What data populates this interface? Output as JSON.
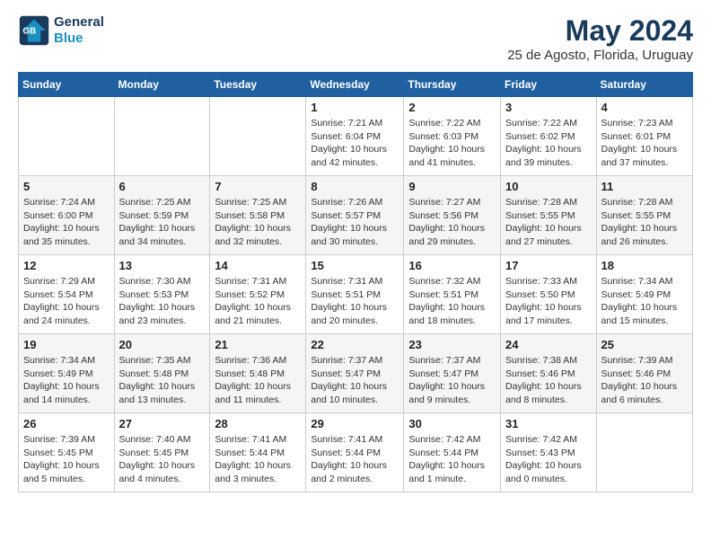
{
  "header": {
    "logo_line1": "General",
    "logo_line2": "Blue",
    "month": "May 2024",
    "location": "25 de Agosto, Florida, Uruguay"
  },
  "weekdays": [
    "Sunday",
    "Monday",
    "Tuesday",
    "Wednesday",
    "Thursday",
    "Friday",
    "Saturday"
  ],
  "weeks": [
    [
      {
        "day": "",
        "sunrise": "",
        "sunset": "",
        "daylight": ""
      },
      {
        "day": "",
        "sunrise": "",
        "sunset": "",
        "daylight": ""
      },
      {
        "day": "",
        "sunrise": "",
        "sunset": "",
        "daylight": ""
      },
      {
        "day": "1",
        "sunrise": "Sunrise: 7:21 AM",
        "sunset": "Sunset: 6:04 PM",
        "daylight": "Daylight: 10 hours and 42 minutes."
      },
      {
        "day": "2",
        "sunrise": "Sunrise: 7:22 AM",
        "sunset": "Sunset: 6:03 PM",
        "daylight": "Daylight: 10 hours and 41 minutes."
      },
      {
        "day": "3",
        "sunrise": "Sunrise: 7:22 AM",
        "sunset": "Sunset: 6:02 PM",
        "daylight": "Daylight: 10 hours and 39 minutes."
      },
      {
        "day": "4",
        "sunrise": "Sunrise: 7:23 AM",
        "sunset": "Sunset: 6:01 PM",
        "daylight": "Daylight: 10 hours and 37 minutes."
      }
    ],
    [
      {
        "day": "5",
        "sunrise": "Sunrise: 7:24 AM",
        "sunset": "Sunset: 6:00 PM",
        "daylight": "Daylight: 10 hours and 35 minutes."
      },
      {
        "day": "6",
        "sunrise": "Sunrise: 7:25 AM",
        "sunset": "Sunset: 5:59 PM",
        "daylight": "Daylight: 10 hours and 34 minutes."
      },
      {
        "day": "7",
        "sunrise": "Sunrise: 7:25 AM",
        "sunset": "Sunset: 5:58 PM",
        "daylight": "Daylight: 10 hours and 32 minutes."
      },
      {
        "day": "8",
        "sunrise": "Sunrise: 7:26 AM",
        "sunset": "Sunset: 5:57 PM",
        "daylight": "Daylight: 10 hours and 30 minutes."
      },
      {
        "day": "9",
        "sunrise": "Sunrise: 7:27 AM",
        "sunset": "Sunset: 5:56 PM",
        "daylight": "Daylight: 10 hours and 29 minutes."
      },
      {
        "day": "10",
        "sunrise": "Sunrise: 7:28 AM",
        "sunset": "Sunset: 5:55 PM",
        "daylight": "Daylight: 10 hours and 27 minutes."
      },
      {
        "day": "11",
        "sunrise": "Sunrise: 7:28 AM",
        "sunset": "Sunset: 5:55 PM",
        "daylight": "Daylight: 10 hours and 26 minutes."
      }
    ],
    [
      {
        "day": "12",
        "sunrise": "Sunrise: 7:29 AM",
        "sunset": "Sunset: 5:54 PM",
        "daylight": "Daylight: 10 hours and 24 minutes."
      },
      {
        "day": "13",
        "sunrise": "Sunrise: 7:30 AM",
        "sunset": "Sunset: 5:53 PM",
        "daylight": "Daylight: 10 hours and 23 minutes."
      },
      {
        "day": "14",
        "sunrise": "Sunrise: 7:31 AM",
        "sunset": "Sunset: 5:52 PM",
        "daylight": "Daylight: 10 hours and 21 minutes."
      },
      {
        "day": "15",
        "sunrise": "Sunrise: 7:31 AM",
        "sunset": "Sunset: 5:51 PM",
        "daylight": "Daylight: 10 hours and 20 minutes."
      },
      {
        "day": "16",
        "sunrise": "Sunrise: 7:32 AM",
        "sunset": "Sunset: 5:51 PM",
        "daylight": "Daylight: 10 hours and 18 minutes."
      },
      {
        "day": "17",
        "sunrise": "Sunrise: 7:33 AM",
        "sunset": "Sunset: 5:50 PM",
        "daylight": "Daylight: 10 hours and 17 minutes."
      },
      {
        "day": "18",
        "sunrise": "Sunrise: 7:34 AM",
        "sunset": "Sunset: 5:49 PM",
        "daylight": "Daylight: 10 hours and 15 minutes."
      }
    ],
    [
      {
        "day": "19",
        "sunrise": "Sunrise: 7:34 AM",
        "sunset": "Sunset: 5:49 PM",
        "daylight": "Daylight: 10 hours and 14 minutes."
      },
      {
        "day": "20",
        "sunrise": "Sunrise: 7:35 AM",
        "sunset": "Sunset: 5:48 PM",
        "daylight": "Daylight: 10 hours and 13 minutes."
      },
      {
        "day": "21",
        "sunrise": "Sunrise: 7:36 AM",
        "sunset": "Sunset: 5:48 PM",
        "daylight": "Daylight: 10 hours and 11 minutes."
      },
      {
        "day": "22",
        "sunrise": "Sunrise: 7:37 AM",
        "sunset": "Sunset: 5:47 PM",
        "daylight": "Daylight: 10 hours and 10 minutes."
      },
      {
        "day": "23",
        "sunrise": "Sunrise: 7:37 AM",
        "sunset": "Sunset: 5:47 PM",
        "daylight": "Daylight: 10 hours and 9 minutes."
      },
      {
        "day": "24",
        "sunrise": "Sunrise: 7:38 AM",
        "sunset": "Sunset: 5:46 PM",
        "daylight": "Daylight: 10 hours and 8 minutes."
      },
      {
        "day": "25",
        "sunrise": "Sunrise: 7:39 AM",
        "sunset": "Sunset: 5:46 PM",
        "daylight": "Daylight: 10 hours and 6 minutes."
      }
    ],
    [
      {
        "day": "26",
        "sunrise": "Sunrise: 7:39 AM",
        "sunset": "Sunset: 5:45 PM",
        "daylight": "Daylight: 10 hours and 5 minutes."
      },
      {
        "day": "27",
        "sunrise": "Sunrise: 7:40 AM",
        "sunset": "Sunset: 5:45 PM",
        "daylight": "Daylight: 10 hours and 4 minutes."
      },
      {
        "day": "28",
        "sunrise": "Sunrise: 7:41 AM",
        "sunset": "Sunset: 5:44 PM",
        "daylight": "Daylight: 10 hours and 3 minutes."
      },
      {
        "day": "29",
        "sunrise": "Sunrise: 7:41 AM",
        "sunset": "Sunset: 5:44 PM",
        "daylight": "Daylight: 10 hours and 2 minutes."
      },
      {
        "day": "30",
        "sunrise": "Sunrise: 7:42 AM",
        "sunset": "Sunset: 5:44 PM",
        "daylight": "Daylight: 10 hours and 1 minute."
      },
      {
        "day": "31",
        "sunrise": "Sunrise: 7:42 AM",
        "sunset": "Sunset: 5:43 PM",
        "daylight": "Daylight: 10 hours and 0 minutes."
      },
      {
        "day": "",
        "sunrise": "",
        "sunset": "",
        "daylight": ""
      }
    ]
  ]
}
